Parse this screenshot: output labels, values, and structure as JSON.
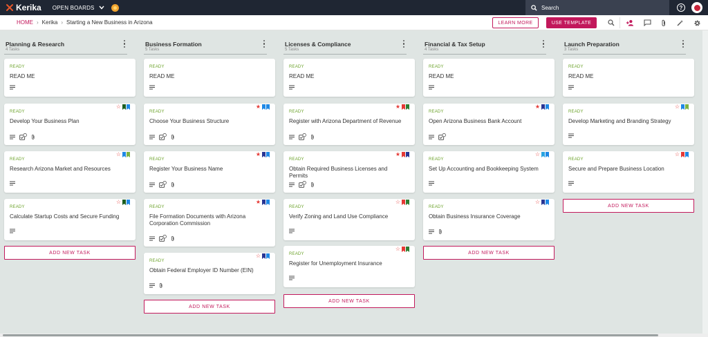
{
  "app": {
    "logo_text": "Kerika",
    "open_boards_label": "OPEN BOARDS"
  },
  "search": {
    "placeholder": "Search"
  },
  "breadcrumb": {
    "home": "HOME",
    "org": "Kerika",
    "board": "Starting a New Business in Arizona"
  },
  "toolbar": {
    "learn_more": "LEARN MORE",
    "use_template": "USE TEMPLATE"
  },
  "icons": {
    "logo": "kerika-logo-icon",
    "search": "search-icon",
    "help": "help-icon",
    "avatar": "user-avatar",
    "zoom": "search-icon",
    "add_person": "add-person-icon",
    "chat": "chat-icon",
    "attach": "paperclip-icon",
    "tools": "magic-wand-icon",
    "settings": "gear-icon",
    "desc": "description-lines-icon",
    "checklist": "checklist-icon",
    "paperclip": "paperclip-icon",
    "star": "star-icon",
    "flag": "bookmark-flag-icon"
  },
  "colors": {
    "accent": "#c2185b",
    "ready": "#6ba229",
    "topbar": "#1f2633",
    "star": "#e53935",
    "flag_red": "#e53935",
    "flag_green": "#2e7d32",
    "flag_blue": "#1e88e5",
    "flag_navy": "#283593",
    "flag_lightblue": "#29a3e0",
    "flag_lime": "#7cb342",
    "flag_darkgreen": "#1b5e20"
  },
  "columns": [
    {
      "title": "Planning & Research",
      "count": "4 Tasks",
      "add_label": "ADD NEW TASK",
      "cards": [
        {
          "status": "READY",
          "title": "READ ME",
          "star": "",
          "flags": [],
          "desc": true,
          "checklist": false,
          "attach": false
        },
        {
          "status": "READY",
          "title": "Develop Your Business Plan",
          "star": "outline",
          "flags": [
            "#1b5e20",
            "#1e88e5"
          ],
          "desc": true,
          "checklist": true,
          "attach": true
        },
        {
          "status": "READY",
          "title": "Research Arizona Market and Resources",
          "star": "outline",
          "flags": [
            "#1e88e5",
            "#7cb342"
          ],
          "desc": true,
          "checklist": false,
          "attach": false
        },
        {
          "status": "READY",
          "title": "Calculate Startup Costs and Secure Funding",
          "star": "outline",
          "flags": [
            "#1b5e20",
            "#1e88e5"
          ],
          "desc": true,
          "checklist": false,
          "attach": false
        }
      ]
    },
    {
      "title": "Business Formation",
      "count": "5 Tasks",
      "add_label": "ADD NEW TASK",
      "cards": [
        {
          "status": "READY",
          "title": "READ ME",
          "star": "",
          "flags": [],
          "desc": true,
          "checklist": false,
          "attach": false
        },
        {
          "status": "READY",
          "title": "Choose Your Business Structure",
          "star": "filled",
          "flags": [
            "#1e88e5",
            "#1e88e5"
          ],
          "desc": true,
          "checklist": true,
          "attach": true
        },
        {
          "status": "READY",
          "title": "Register Your Business Name",
          "star": "filled",
          "flags": [
            "#283593",
            "#1e88e5"
          ],
          "desc": true,
          "checklist": true,
          "attach": true
        },
        {
          "status": "READY",
          "title": "File Formation Documents with Arizona Corporation Commission",
          "star": "filled",
          "flags": [
            "#283593",
            "#1e88e5"
          ],
          "desc": true,
          "checklist": true,
          "attach": true
        },
        {
          "status": "READY",
          "title": "Obtain Federal Employer ID Number (EIN)",
          "star": "outline",
          "flags": [
            "#283593",
            "#1e88e5"
          ],
          "desc": true,
          "checklist": false,
          "attach": true
        }
      ]
    },
    {
      "title": "Licenses & Compliance",
      "count": "5 Tasks",
      "add_label": "ADD NEW TASK",
      "cards": [
        {
          "status": "READY",
          "title": "READ ME",
          "star": "",
          "flags": [],
          "desc": true,
          "checklist": false,
          "attach": false
        },
        {
          "status": "READY",
          "title": "Register with Arizona Department of Revenue",
          "star": "filled",
          "flags": [
            "#e53935",
            "#2e7d32"
          ],
          "desc": true,
          "checklist": true,
          "attach": true
        },
        {
          "status": "READY",
          "title": "Obtain Required Business Licenses and Permits",
          "star": "filled",
          "flags": [
            "#e53935",
            "#283593"
          ],
          "desc": true,
          "checklist": true,
          "attach": true
        },
        {
          "status": "READY",
          "title": "Verify Zoning and Land Use Compliance",
          "star": "outline",
          "flags": [
            "#e53935",
            "#2e7d32"
          ],
          "desc": true,
          "checklist": false,
          "attach": false
        },
        {
          "status": "READY",
          "title": "Register for Unemployment Insurance",
          "star": "outline",
          "flags": [
            "#e53935",
            "#2e7d32"
          ],
          "desc": true,
          "checklist": false,
          "attach": false
        }
      ]
    },
    {
      "title": "Financial & Tax Setup",
      "count": "4 Tasks",
      "add_label": "ADD NEW TASK",
      "cards": [
        {
          "status": "READY",
          "title": "READ ME",
          "star": "",
          "flags": [],
          "desc": true,
          "checklist": false,
          "attach": false
        },
        {
          "status": "READY",
          "title": "Open Arizona Business Bank Account",
          "star": "filled",
          "flags": [
            "#283593",
            "#1e88e5"
          ],
          "desc": true,
          "checklist": true,
          "attach": false
        },
        {
          "status": "READY",
          "title": "Set Up Accounting and Bookkeeping System",
          "star": "outline",
          "flags": [
            "#29a3e0",
            "#1e88e5"
          ],
          "desc": true,
          "checklist": false,
          "attach": false
        },
        {
          "status": "READY",
          "title": "Obtain Business Insurance Coverage",
          "star": "outline",
          "flags": [
            "#283593",
            "#1e88e5"
          ],
          "desc": true,
          "checklist": false,
          "attach": true
        }
      ]
    },
    {
      "title": "Launch Preparation",
      "count": "3 Tasks",
      "add_label": "ADD NEW TASK",
      "cards": [
        {
          "status": "READY",
          "title": "READ ME",
          "star": "",
          "flags": [],
          "desc": true,
          "checklist": false,
          "attach": false
        },
        {
          "status": "READY",
          "title": "Develop Marketing and Branding Strategy",
          "star": "outline",
          "flags": [
            "#1e88e5",
            "#7cb342"
          ],
          "desc": true,
          "checklist": false,
          "attach": false
        },
        {
          "status": "READY",
          "title": "Secure and Prepare Business Location",
          "star": "outline",
          "flags": [
            "#e53935",
            "#1e88e5"
          ],
          "desc": true,
          "checklist": false,
          "attach": false
        }
      ]
    }
  ]
}
